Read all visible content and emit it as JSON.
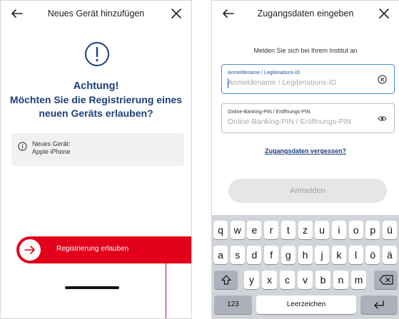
{
  "screen1": {
    "title": "Neues Gerät hinzufügen",
    "warning_title": "Achtung!",
    "warning_text": "Möchten Sie die Registrierung eines neuen Geräts erlauben?",
    "device_label": "Neues Gerät:",
    "device_value": "Apple iPhone",
    "allow_button": "Registrierung erlauben",
    "brand_color": "#e2001a",
    "text_color": "#1c3f7a"
  },
  "screen2": {
    "title": "Zugangsdaten eingeben",
    "intro": "Melden Sie sich bei Ihrem Institut an",
    "username": {
      "label": "Anmeldename / Legitimations-ID",
      "placeholder": "Anmeldename / Legitimations-ID",
      "value": ""
    },
    "pin": {
      "label": "Online-Banking-PIN / Eröffnungs-PIN",
      "placeholder": "Online-Banking-PIN / Eröffnungs-PIN",
      "value": ""
    },
    "forgot_link": "Zugangsdaten vergessen?",
    "login_button": "Anmelden",
    "keyboard": {
      "row1": [
        "q",
        "w",
        "e",
        "r",
        "t",
        "z",
        "u",
        "i",
        "o",
        "p",
        "ü"
      ],
      "row2": [
        "a",
        "s",
        "d",
        "f",
        "g",
        "h",
        "j",
        "k",
        "l",
        "ö",
        "ä"
      ],
      "row3": [
        "y",
        "x",
        "c",
        "v",
        "b",
        "n",
        "m"
      ],
      "numbers_key": "123",
      "space_key": "Leerzeichen",
      "icons": [
        "shift-icon",
        "backspace-icon",
        "return-icon"
      ]
    }
  }
}
